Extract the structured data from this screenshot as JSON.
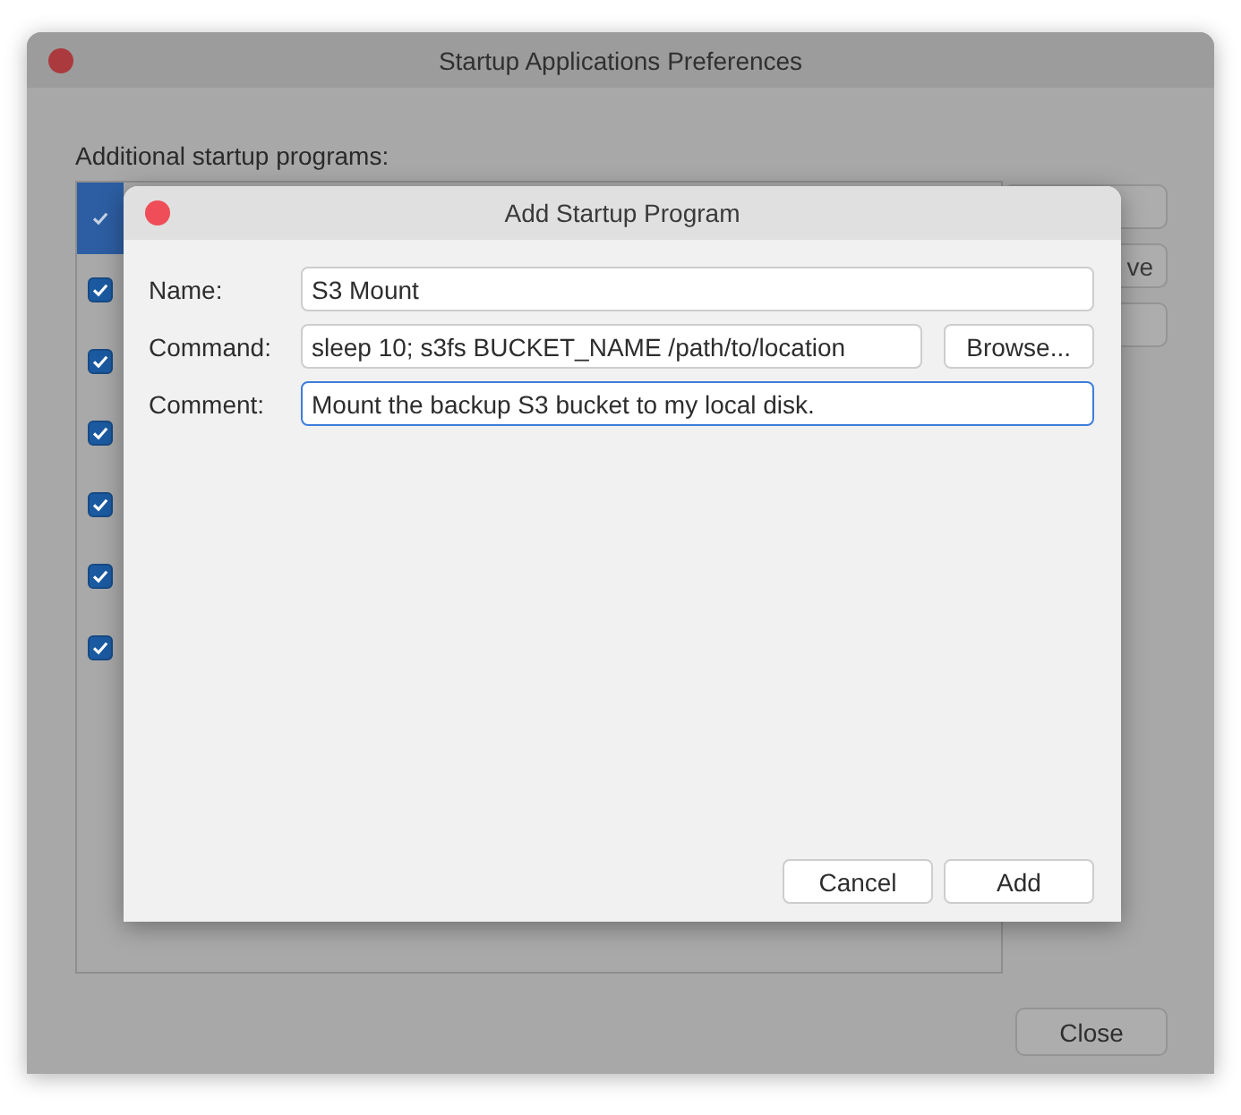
{
  "window": {
    "title": "Startup Applications Preferences",
    "list_label": "Additional startup programs:",
    "programs": [
      {
        "checked": true,
        "selected": true
      },
      {
        "checked": true,
        "selected": false
      },
      {
        "checked": true,
        "selected": false
      },
      {
        "checked": true,
        "selected": false
      },
      {
        "checked": true,
        "selected": false
      },
      {
        "checked": true,
        "selected": false
      },
      {
        "checked": true,
        "selected": false
      }
    ],
    "side_buttons": [
      {
        "kind": "blank"
      },
      {
        "kind": "labeled",
        "label": "ve"
      },
      {
        "kind": "blank"
      }
    ],
    "close_button": "Close"
  },
  "dialog": {
    "title": "Add Startup Program",
    "fields": [
      {
        "label": "Name:",
        "value": "S3 Mount",
        "focused": false
      },
      {
        "label": "Command:",
        "value": "sleep 10; s3fs BUCKET_NAME /path/to/location",
        "focused": false,
        "button": "Browse..."
      },
      {
        "label": "Comment:",
        "value": "Mount the backup S3 bucket to my local disk.",
        "focused": true
      }
    ],
    "buttons": [
      "Cancel",
      "Add"
    ]
  }
}
